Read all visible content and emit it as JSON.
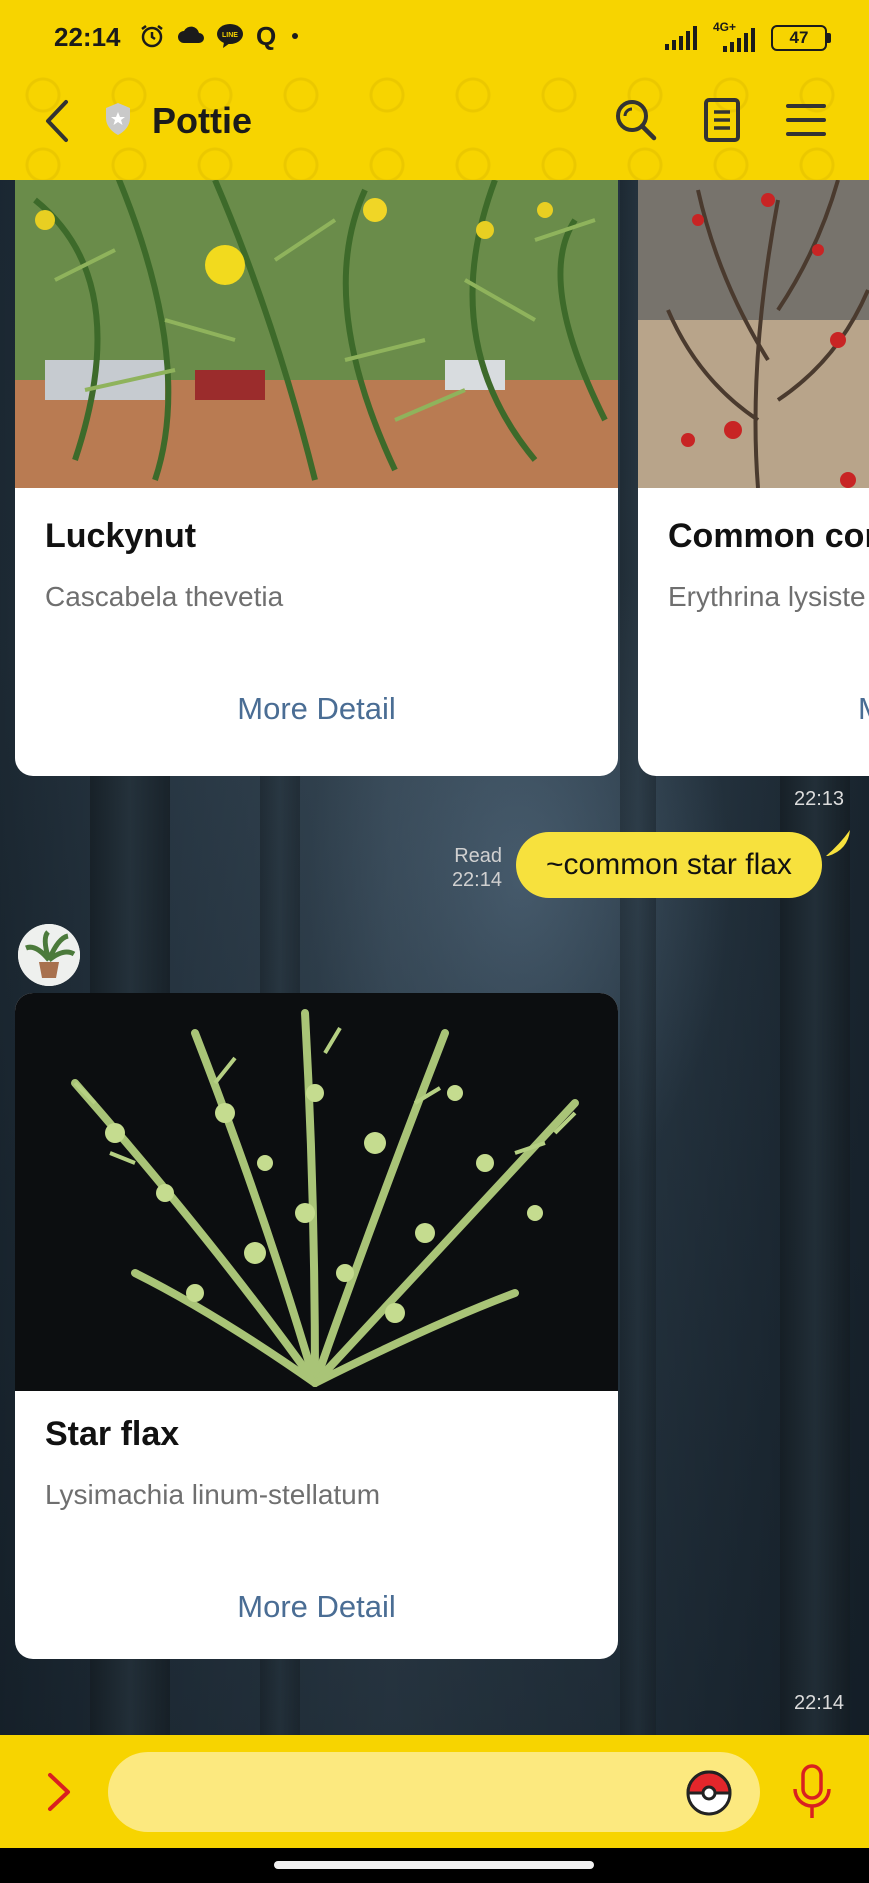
{
  "status_bar": {
    "time": "22:14",
    "icons": [
      "alarm-icon",
      "cloud-icon",
      "line-icon",
      "q-icon",
      "dot-icon"
    ],
    "network": "4G+",
    "battery": "47"
  },
  "header": {
    "title": "Pottie",
    "bg": "#f7d400",
    "icons": [
      "back-icon",
      "shield-icon",
      "search-icon",
      "notes-icon",
      "menu-icon"
    ]
  },
  "chat": {
    "carousel_1": {
      "cards": [
        {
          "title": "Luckynut",
          "scientific_name": "Cascabela thevetia",
          "button": "More Detail"
        },
        {
          "title": "Common cor",
          "scientific_name": "Erythrina lysiste",
          "button": "M"
        }
      ],
      "timestamp": "22:13"
    },
    "user_message": {
      "read_label": "Read",
      "read_time": "22:14",
      "text": "~common star flax"
    },
    "carousel_2": {
      "cards": [
        {
          "title": "Star flax",
          "scientific_name": "Lysimachia linum-stellatum",
          "button": "More Detail"
        }
      ],
      "timestamp": "22:14"
    }
  },
  "input_bar": {
    "placeholder": "",
    "icons": [
      "chevron-right-icon",
      "pokeball-icon",
      "mic-icon"
    ],
    "accent": "#d92020"
  },
  "colors": {
    "yellow": "#f7d400",
    "bubble": "#f7e13d",
    "link": "#4a6d94"
  }
}
